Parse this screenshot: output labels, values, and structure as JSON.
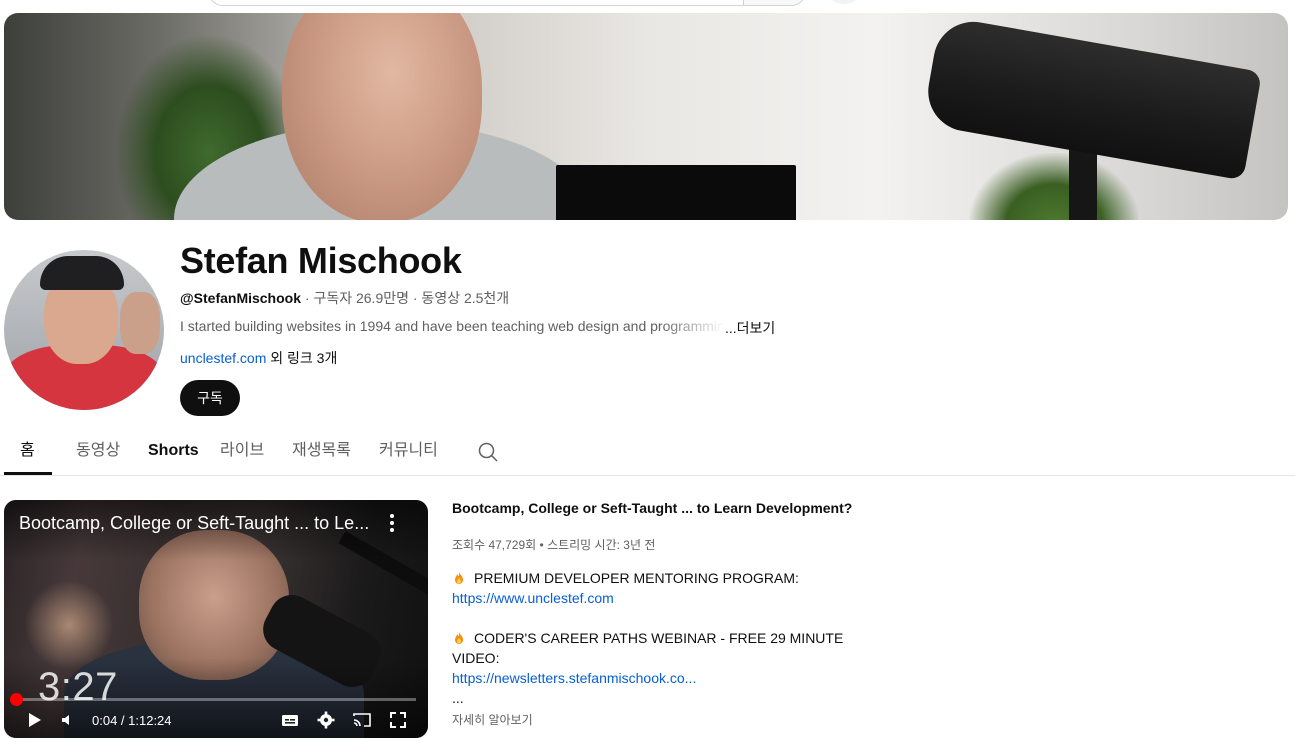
{
  "channel": {
    "name": "Stefan Mischook",
    "handle": "@StefanMischook",
    "stats": " · 구독자 26.9만명 · 동영상 2.5천개",
    "description": "I started building websites in 1994 and have been teaching web design and programming",
    "more_label": "...더보기",
    "link_text": "unclestef.com",
    "link_extra": " 외 링크 3개",
    "subscribe_label": "구독"
  },
  "tabs": [
    {
      "label": "홈"
    },
    {
      "label": "동영상"
    },
    {
      "label": "Shorts"
    },
    {
      "label": "라이브"
    },
    {
      "label": "재생목록"
    },
    {
      "label": "커뮤니티"
    }
  ],
  "featured_video": {
    "overlay_title": "Bootcamp, College or Seft-Taught ... to Le...",
    "thumbnail_duration": "3:27",
    "time": "0:04 / 1:12:24",
    "progress_fraction": 0.001,
    "details": {
      "title": "Bootcamp, College or Seft-Taught ... to Learn Development?",
      "stats": "조회수 47,729회 • 스트리밍 시간: 3년 전",
      "line1": "PREMIUM DEVELOPER MENTORING PROGRAM:",
      "link1": "https://www.unclestef.com",
      "line2": "CODER'S CAREER PATHS WEBINAR - FREE 29 MINUTE",
      "line3": "VIDEO:",
      "link2": "https://newsletters.stefanmischook.co...",
      "ellipsis": "...",
      "more": "자세히 알아보기"
    }
  },
  "icons": {
    "tab_search": "search-icon",
    "video_menu": "more-vert-icon",
    "fire": "fire-icon",
    "controls": [
      "play-icon",
      "volume-icon",
      "subtitles-icon",
      "settings-icon",
      "cast-icon",
      "fullscreen-icon"
    ]
  },
  "colors": {
    "link": "#065fd4",
    "progress": "#ff0000",
    "subscribe_bg": "#0f0f0f"
  }
}
